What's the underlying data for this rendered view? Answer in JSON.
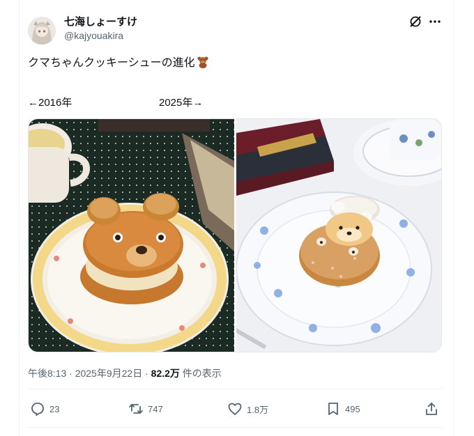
{
  "user": {
    "display_name": "七海しょーすけ",
    "handle": "@kajyouakira"
  },
  "header": {
    "grok_icon": "grok-icon",
    "more_icon": "more-icon"
  },
  "post": {
    "text": "クマちゃんクッキーシューの進化",
    "emoji": "teddy-bear-emoji",
    "label_left": "←2016年",
    "label_right": "2025年→"
  },
  "meta": {
    "time": "午後8:13",
    "separator1": " · ",
    "date": "2025年9月22日",
    "separator2": " · ",
    "views_count": "82.2万",
    "views_label": " 件の表示"
  },
  "actions": {
    "replies": "23",
    "reposts": "747",
    "likes": "1.8万",
    "bookmarks": "495"
  },
  "colors": {
    "text": "#0f1419",
    "secondary": "#536471",
    "border": "#eff3f4"
  }
}
